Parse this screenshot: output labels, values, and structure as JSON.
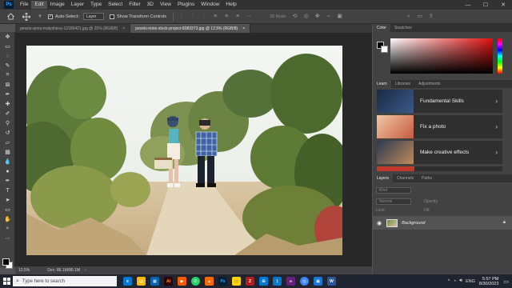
{
  "menubar": {
    "logo": "Ps",
    "items": [
      "File",
      "Edit",
      "Image",
      "Layer",
      "Type",
      "Select",
      "Filter",
      "3D",
      "View",
      "Plugins",
      "Window",
      "Help"
    ],
    "active_index": 1
  },
  "window_controls": {
    "minimize": "—",
    "maximize": "☐",
    "close": "✕"
  },
  "options_bar": {
    "auto_select_label": "Auto-Select:",
    "auto_select_value": "Layer",
    "show_transform_label": "Show Transform Controls",
    "mode_3d_label": "3D Mode:"
  },
  "tabs": [
    {
      "label": "pexels-anna-malysheva-12186421.jpg @ 25% (RGB/8)",
      "close": "×",
      "active": false
    },
    {
      "label": "pexels-mine-stock-project-8083373.jpg @ 12.5% (RGB/8)",
      "close": "×",
      "active": true
    }
  ],
  "status": {
    "zoom": "12.5%",
    "doc": "Doc: 86.1M/86.1M"
  },
  "color_panel": {
    "tabs": [
      "Color",
      "Swatches"
    ],
    "hue_color": "#e01010"
  },
  "learn_panel": {
    "tabs": [
      "Learn",
      "Libraries",
      "Adjustments"
    ],
    "cards": [
      {
        "label": "Fundamental Skills"
      },
      {
        "label": "Fix a photo"
      },
      {
        "label": "Make creative effects"
      }
    ]
  },
  "layers_panel": {
    "tabs": [
      "Layers",
      "Channels",
      "Paths"
    ],
    "kind_placeholder": "Kind",
    "blend_mode": "Normal",
    "opacity_label": "Opacity:",
    "lock_label": "Lock:",
    "fill_label": "Fill:",
    "layer_name": "Background"
  },
  "taskbar": {
    "search_placeholder": "Type here to search",
    "language": "ENG",
    "time": "5:57 PM",
    "date": "8/30/2023",
    "app_colors": [
      "#0078d4",
      "#ff9a00",
      "#0a64ad",
      "#ff5a00",
      "#25d366",
      "#ff6a00",
      "#31a8ff",
      "#ffd400",
      "#e33f2a",
      "#0078d4",
      "#007acc",
      "#68217a",
      "#3e86f4",
      "#1976d2"
    ]
  }
}
